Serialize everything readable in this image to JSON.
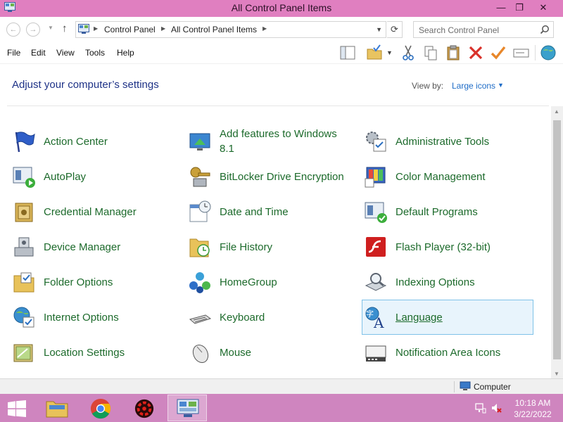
{
  "window": {
    "title": "All Control Panel Items",
    "minimize_glyph": "—",
    "maximize_glyph": "❐",
    "close_glyph": "✕"
  },
  "nav": {
    "back_glyph": "←",
    "forward_glyph": "→",
    "up_glyph": "↑",
    "refresh_glyph": "⟳",
    "breadcrumbs": [
      "Control Panel",
      "All Control Panel Items"
    ],
    "search_placeholder": "Search Control Panel"
  },
  "menu": [
    "File",
    "Edit",
    "View",
    "Tools",
    "Help"
  ],
  "toolbar_icons": [
    "layout-pane-icon",
    "folder-check-icon",
    "cut-icon",
    "copy-icon",
    "paste-icon",
    "delete-icon",
    "checkmark-icon",
    "rename-icon",
    "globe-icon"
  ],
  "content": {
    "heading": "Adjust your computer’s settings",
    "view_by_label": "View by:",
    "view_by_value": "Large icons"
  },
  "items": [
    {
      "label": "Action Center",
      "icon": "flag-icon"
    },
    {
      "label": "Add features to Windows 8.1",
      "icon": "add-features-icon"
    },
    {
      "label": "Administrative Tools",
      "icon": "admin-tools-icon"
    },
    {
      "label": "AutoPlay",
      "icon": "autoplay-icon"
    },
    {
      "label": "BitLocker Drive Encryption",
      "icon": "bitlocker-keys-icon"
    },
    {
      "label": "Color Management",
      "icon": "color-management-icon"
    },
    {
      "label": "Credential Manager",
      "icon": "credential-vault-icon"
    },
    {
      "label": "Date and Time",
      "icon": "calendar-clock-icon"
    },
    {
      "label": "Default Programs",
      "icon": "default-programs-icon"
    },
    {
      "label": "Device Manager",
      "icon": "device-manager-icon"
    },
    {
      "label": "File History",
      "icon": "file-history-icon"
    },
    {
      "label": "Flash Player (32-bit)",
      "icon": "flash-player-icon"
    },
    {
      "label": "Folder Options",
      "icon": "folder-options-icon"
    },
    {
      "label": "HomeGroup",
      "icon": "homegroup-icon"
    },
    {
      "label": "Indexing Options",
      "icon": "indexing-icon"
    },
    {
      "label": "Internet Options",
      "icon": "internet-options-icon"
    },
    {
      "label": "Keyboard",
      "icon": "keyboard-icon"
    },
    {
      "label": "Language",
      "icon": "language-icon",
      "selected": true
    },
    {
      "label": "Location Settings",
      "icon": "location-icon"
    },
    {
      "label": "Mouse",
      "icon": "mouse-icon"
    },
    {
      "label": "Notification Area Icons",
      "icon": "notification-icon"
    }
  ],
  "status": {
    "location": "Computer"
  },
  "taskbar": {
    "apps": [
      "file-explorer-icon",
      "chrome-icon",
      "red-app-icon",
      "control-panel-icon"
    ],
    "time": "10:18 AM",
    "date": "3/22/2022"
  },
  "colors": {
    "titlebar": "#e07fc0",
    "taskbar": "#cf85bf",
    "item_label": "#1c6a2b",
    "heading": "#1e3287",
    "link": "#1e6cc7",
    "selection_border": "#7fc2e8",
    "selection_fill": "#e8f4fc"
  }
}
